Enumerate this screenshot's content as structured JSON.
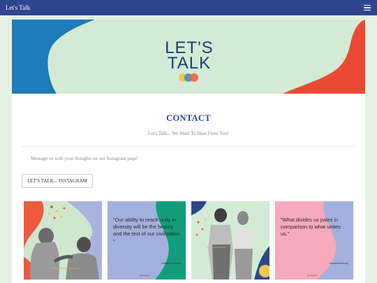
{
  "navbar": {
    "brand": "Let's Talk",
    "menu_icon": "hamburger-icon"
  },
  "banner": {
    "logo_lines": [
      "LET'S",
      "TALK"
    ],
    "colors": {
      "background": "#d3ebd4",
      "left_blob": "#1e7cba",
      "right_blob": "#ea4a33",
      "logo_text": "#1d3a76",
      "dots": [
        "#f0c74b",
        "#5d8bc4",
        "#e8674d"
      ]
    }
  },
  "contact": {
    "title": "CONTACT",
    "subtitle": "Let's Talk... We Want To Hear From You!",
    "message": "Message us with your thoughts on our Instagram page!",
    "button_label": "LET'S TALK... INSTAGRAM"
  },
  "posts": [
    {
      "kind": "photo",
      "description_icon": "photo-two-people-laughing"
    },
    {
      "kind": "quote",
      "text": "\"Our ability to reach unity in diversity will be the beauty and the test of our civilization. \"",
      "author": "Mahatma Gandhi",
      "handle": "@letstalk.dei",
      "colors": {
        "background": "#a3b0dd",
        "accent": "#129e7c"
      }
    },
    {
      "kind": "photo",
      "description_icon": "photo-two-women-standing"
    },
    {
      "kind": "quote",
      "text": "\"What divides us pales in comparison to what unites us.\"",
      "author": "Edward Kennedy",
      "handle": "@letstalk.dei",
      "colors": {
        "background": "#a3b0dd",
        "accent": "#f7aabb"
      }
    }
  ]
}
